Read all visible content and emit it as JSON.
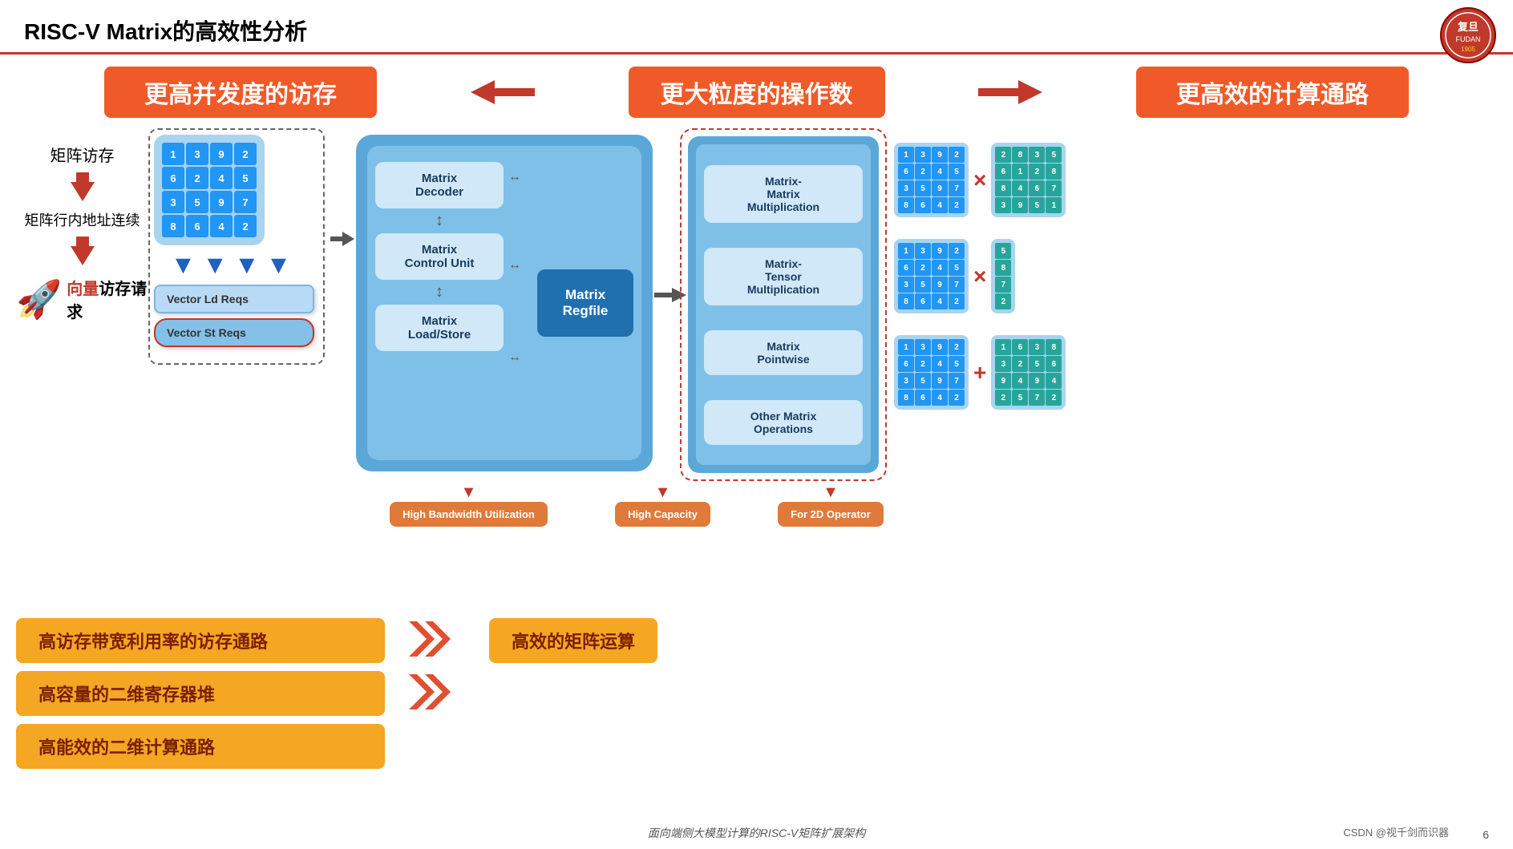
{
  "title": "RISC-V Matrix的高效性分析",
  "top_banners": {
    "left": "更高并发度的访存",
    "center": "更大粒度的操作数",
    "right": "更高效的计算通路"
  },
  "left_section": {
    "label1": "矩阵访存",
    "label2": "矩阵行内地址连续",
    "vector_label": "向量访存请求"
  },
  "matrix_grid": [
    [
      1,
      3,
      9,
      2
    ],
    [
      6,
      2,
      4,
      5
    ],
    [
      3,
      5,
      9,
      7
    ],
    [
      8,
      6,
      4,
      2
    ]
  ],
  "vector_boxes": {
    "ld": "Vector Ld Reqs",
    "st": "Vector St Reqs"
  },
  "pipeline": {
    "decoder": "Matrix\nDecoder",
    "control": "Matrix\nControl Unit",
    "load_store": "Matrix\nLoad/Store",
    "regfile": "Matrix\nRegfile"
  },
  "operations": {
    "mm": "Matrix-\nMatrix\nMultiplication",
    "tensor": "Matrix-\nTensor\nMultiplication",
    "pointwise": "Matrix\nPointwise",
    "other": "Other Matrix\nOperations"
  },
  "bottom_labels": {
    "bw": "High\nBandwidth\nUtilization",
    "cap": "High\nCapacity",
    "op2d": "For 2D\nOperator"
  },
  "matrix_right": {
    "grid1a": [
      [
        1,
        3,
        9,
        2
      ],
      [
        6,
        2,
        4,
        5
      ],
      [
        3,
        5,
        9,
        7
      ],
      [
        8,
        6,
        4,
        2
      ]
    ],
    "grid1b": [
      [
        2,
        8,
        3,
        5
      ],
      [
        6,
        1,
        2,
        8
      ],
      [
        8,
        4,
        6,
        7
      ],
      [
        3,
        9,
        5,
        1
      ]
    ],
    "op1": "×",
    "grid2a": [
      [
        1,
        3,
        9,
        2
      ],
      [
        6,
        2,
        4,
        5
      ],
      [
        3,
        5,
        9,
        7
      ],
      [
        8,
        6,
        4,
        2
      ]
    ],
    "col2b": [
      5,
      8,
      7,
      2
    ],
    "op2": "×",
    "grid3a": [
      [
        1,
        3,
        9,
        2
      ],
      [
        6,
        2,
        4,
        5
      ],
      [
        3,
        5,
        9,
        7
      ],
      [
        8,
        6,
        4,
        2
      ]
    ],
    "grid3b": [
      [
        1,
        6,
        3,
        8
      ],
      [
        3,
        2,
        5,
        6
      ],
      [
        9,
        4,
        9,
        4
      ],
      [
        2,
        5,
        7,
        2
      ]
    ],
    "op3": "+"
  },
  "bottom_banners": {
    "b1": "高访存带宽利用率的访存通路",
    "b2": "高容量的二维寄存器堆",
    "b3": "高能效的二维计算通路",
    "efficient": "高效的矩阵运算"
  },
  "footer": "面向端侧大模型计算的RISC-V矩阵扩展架构",
  "page_num": "6",
  "csdn": "CSDN @视千剑而识器"
}
